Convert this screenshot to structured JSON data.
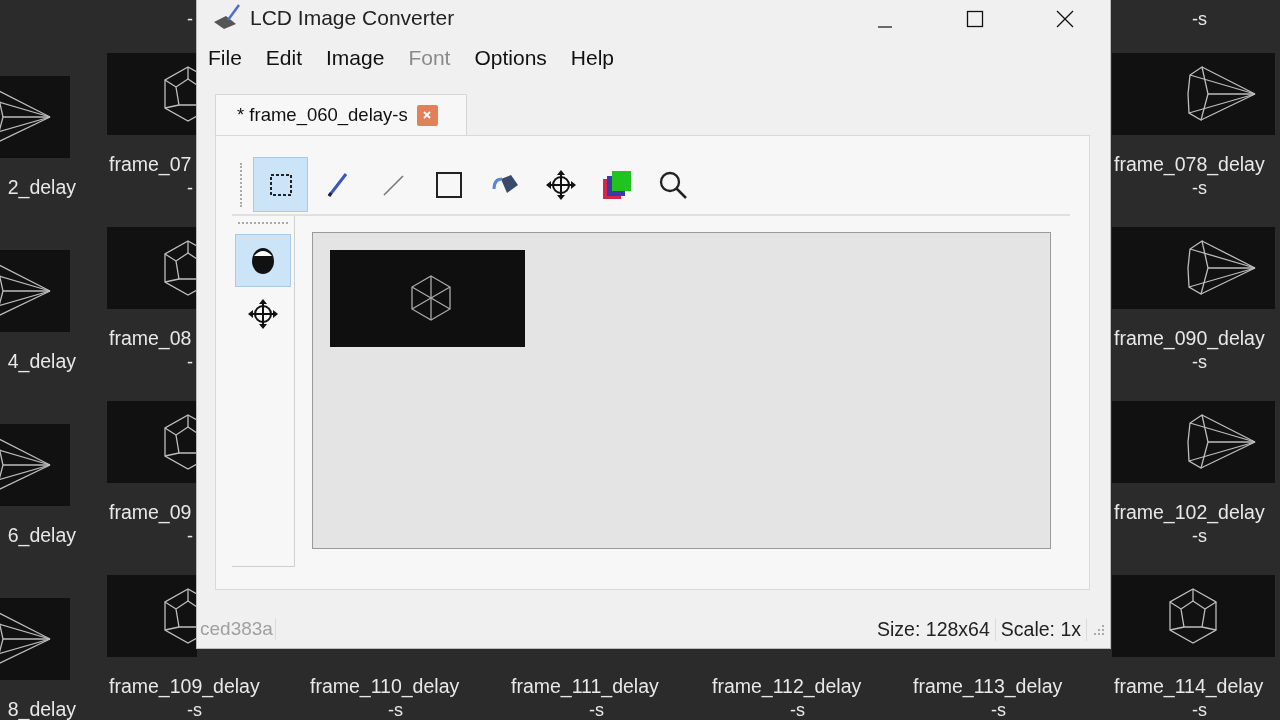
{
  "desktop": {
    "columns": [
      {
        "tiles": [
          {
            "kind": "picture",
            "label": "2_delay"
          },
          {
            "kind": "picture",
            "label": "4_delay"
          },
          {
            "kind": "picture",
            "label": "6_delay"
          },
          {
            "kind": "picture",
            "label": "8_delay"
          }
        ]
      },
      {
        "top_sublabel": "-",
        "tiles": [
          {
            "kind": "picture",
            "label": "frame_07",
            "sublabel": "-"
          },
          {
            "kind": "picture",
            "label": "frame_08",
            "sublabel": "-"
          },
          {
            "kind": "picture",
            "label": "frame_09",
            "sublabel": "-"
          },
          {
            "kind": "picture",
            "label": "frame_109_delay",
            "sublabel": "-s"
          }
        ]
      },
      {
        "tiles": [
          {
            "label": "frame_110_delay",
            "sublabel": "-s"
          }
        ]
      },
      {
        "tiles": [
          {
            "label": "frame_111_delay",
            "sublabel": "-s"
          }
        ]
      },
      {
        "tiles": [
          {
            "label": "frame_112_delay",
            "sublabel": "-s"
          }
        ]
      },
      {
        "tiles": [
          {
            "label": "frame_113_delay",
            "sublabel": "-s"
          }
        ]
      },
      {
        "top_sublabel": "-s",
        "tiles": [
          {
            "kind": "picture",
            "label": "frame_078_delay",
            "sublabel": "-s"
          },
          {
            "kind": "picture",
            "label": "frame_090_delay",
            "sublabel": "-s"
          },
          {
            "kind": "picture",
            "label": "frame_102_delay",
            "sublabel": "-s"
          },
          {
            "kind": "picture",
            "label": "frame_114_delay",
            "sublabel": "-s"
          }
        ]
      }
    ]
  },
  "window": {
    "title": "LCD Image Converter",
    "menu": [
      {
        "label": "File",
        "disabled": false
      },
      {
        "label": "Edit",
        "disabled": false
      },
      {
        "label": "Image",
        "disabled": false
      },
      {
        "label": "Font",
        "disabled": true
      },
      {
        "label": "Options",
        "disabled": false
      },
      {
        "label": "Help",
        "disabled": false
      }
    ],
    "tabs": [
      {
        "label": "* frame_060_delay-s",
        "selected": true
      }
    ],
    "tools": [
      {
        "kind": "select",
        "selected": true
      },
      {
        "kind": "pen",
        "selected": false
      },
      {
        "kind": "line",
        "selected": false
      },
      {
        "kind": "rect",
        "selected": false
      },
      {
        "kind": "fill",
        "selected": false
      },
      {
        "kind": "move",
        "selected": false
      },
      {
        "kind": "colors",
        "selected": false
      },
      {
        "kind": "zoom",
        "selected": false
      }
    ],
    "side_tools": [
      {
        "kind": "inverse",
        "selected": true
      },
      {
        "kind": "move",
        "selected": false
      }
    ],
    "status_bar": {
      "hint": "ced383a",
      "size": "Size: 128x64",
      "scale": "Scale: 1x"
    }
  }
}
